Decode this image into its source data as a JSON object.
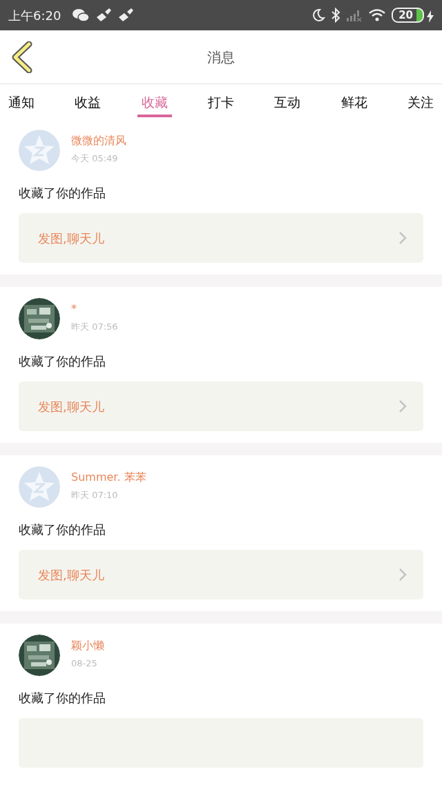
{
  "status_bar": {
    "time": "上午6:20",
    "battery": "20"
  },
  "header": {
    "title": "消息"
  },
  "tabs": [
    {
      "label": "通知",
      "selected": false
    },
    {
      "label": "收益",
      "selected": false
    },
    {
      "label": "收藏",
      "selected": true
    },
    {
      "label": "打卡",
      "selected": false
    },
    {
      "label": "互动",
      "selected": false
    },
    {
      "label": "鲜花",
      "selected": false
    },
    {
      "label": "关注",
      "selected": false
    }
  ],
  "messages": [
    {
      "avatar": {
        "kind": "default"
      },
      "name": "微微的清风",
      "time": "今天 05:49",
      "text": "收藏了你的作品",
      "quote": "发图,聊天儿"
    },
    {
      "name": "*",
      "time": "昨天 07:56",
      "text": "收藏了你的作品",
      "quote": "发图,聊天儿"
    },
    {
      "avatar": {
        "kind": "default"
      },
      "name": "Summer. 苯苯",
      "time": "昨天 07:10",
      "text": "收藏了你的作品",
      "quote": "发图,聊天儿"
    },
    {
      "name": "颖小懒",
      "time": "08-25",
      "text": "收藏了你的作品",
      "quote_cut_off": true
    }
  ]
}
